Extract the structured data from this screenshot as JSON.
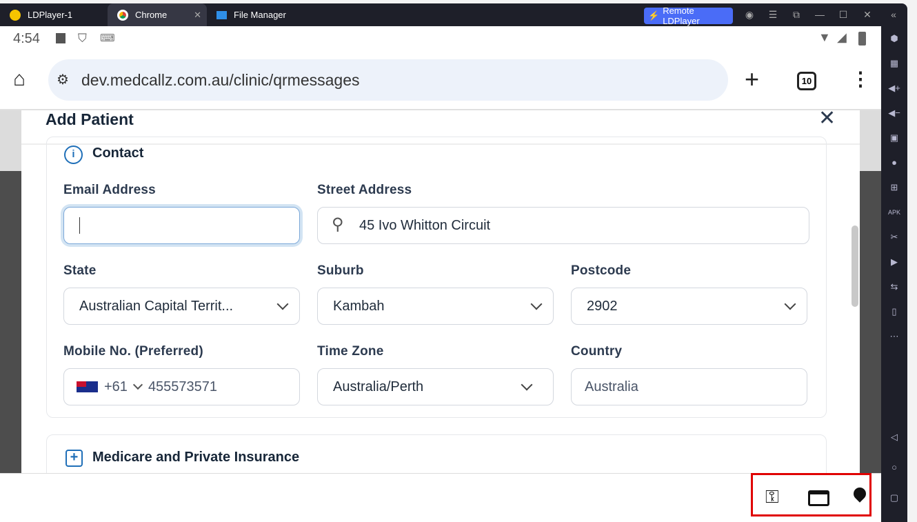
{
  "window": {
    "tabs": [
      {
        "label": "LDPlayer-1"
      },
      {
        "label": "Chrome"
      },
      {
        "label": "File Manager"
      }
    ],
    "remote_label": "Remote LDPlayer"
  },
  "status": {
    "time": "4:54"
  },
  "browser": {
    "url": "dev.medcallz.com.au/clinic/qrmessages",
    "tab_count": "10"
  },
  "modal": {
    "title": "Add Patient",
    "contact_section": "Contact",
    "fields": {
      "email": {
        "label": "Email Address",
        "value": ""
      },
      "street": {
        "label": "Street Address",
        "value": "45 Ivo Whitton Circuit"
      },
      "state": {
        "label": "State",
        "value": "Australian Capital Territ..."
      },
      "suburb": {
        "label": "Suburb",
        "value": "Kambah"
      },
      "postcode": {
        "label": "Postcode",
        "value": "2902"
      },
      "mobile": {
        "label": "Mobile No. (Preferred)",
        "code": "+61",
        "value": "455573571"
      },
      "timezone": {
        "label": "Time Zone",
        "value": "Australia/Perth"
      },
      "country": {
        "label": "Country",
        "value": "Australia"
      }
    },
    "insurance_section": "Medicare and Private Insurance"
  },
  "colors": {
    "accent": "#1f6fb8",
    "highlight_box": "#e00000",
    "remote": "#4a6cf7"
  }
}
